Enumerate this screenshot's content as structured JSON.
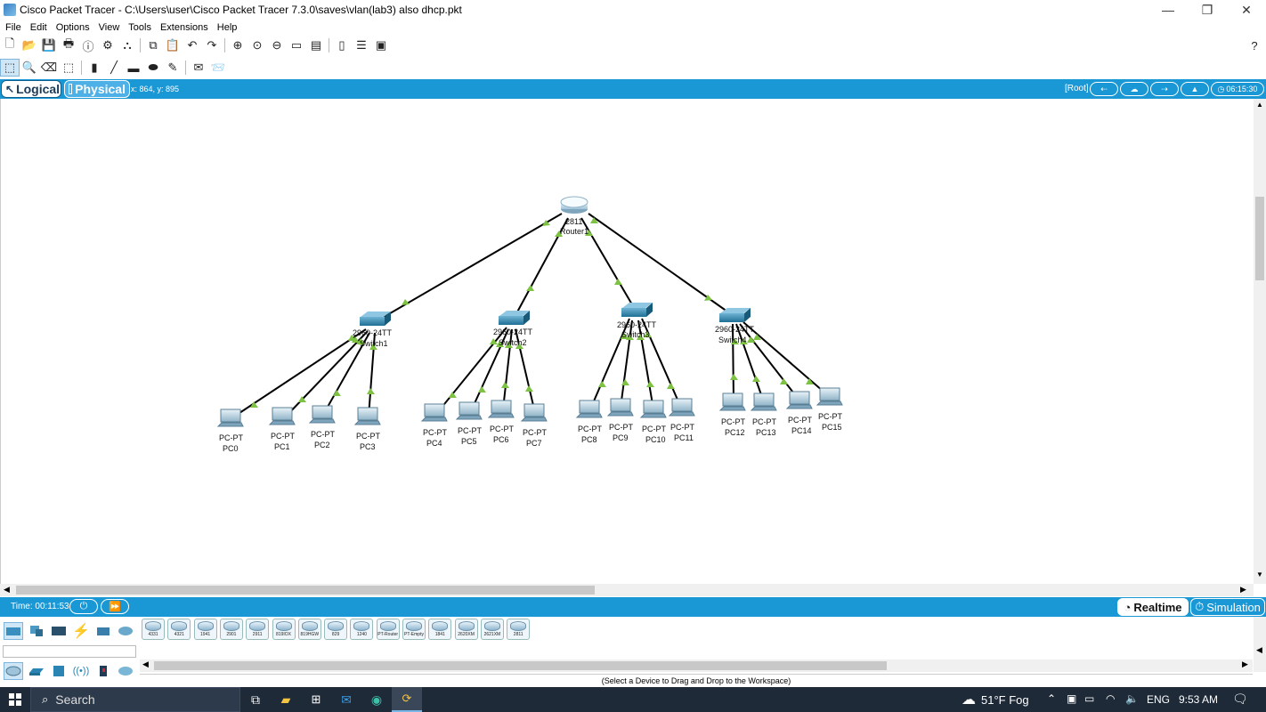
{
  "window": {
    "title": "Cisco Packet Tracer - C:\\Users\\user\\Cisco Packet Tracer 7.3.0\\saves\\vlan(lab3) also dhcp.pkt",
    "minimize": "—",
    "maximize": "❐",
    "close": "✕"
  },
  "menu": [
    "File",
    "Edit",
    "Options",
    "View",
    "Tools",
    "Extensions",
    "Help"
  ],
  "toolbar": {
    "help": "?"
  },
  "workspace_bar": {
    "logical_label": "Logical",
    "physical_label": "Physical",
    "coords": "x: 864, y: 895",
    "root_label": "[Root]",
    "clock": "06:15:30"
  },
  "topology": {
    "router": {
      "model": "2811",
      "name": "Router1"
    },
    "switches": [
      {
        "model": "2960-24TT",
        "name": "Switch1"
      },
      {
        "model": "2960-24TT",
        "name": "Switch2"
      },
      {
        "model": "2960-24TT",
        "name": "Switch3"
      },
      {
        "model": "2960-24TT",
        "name": "Switch4"
      }
    ],
    "pcs": [
      {
        "model": "PC-PT",
        "name": "PC0"
      },
      {
        "model": "PC-PT",
        "name": "PC1"
      },
      {
        "model": "PC-PT",
        "name": "PC2"
      },
      {
        "model": "PC-PT",
        "name": "PC3"
      },
      {
        "model": "PC-PT",
        "name": "PC4"
      },
      {
        "model": "PC-PT",
        "name": "PC5"
      },
      {
        "model": "PC-PT",
        "name": "PC6"
      },
      {
        "model": "PC-PT",
        "name": "PC7"
      },
      {
        "model": "PC-PT",
        "name": "PC8"
      },
      {
        "model": "PC-PT",
        "name": "PC9"
      },
      {
        "model": "PC-PT",
        "name": "PC10"
      },
      {
        "model": "PC-PT",
        "name": "PC11"
      },
      {
        "model": "PC-PT",
        "name": "PC12"
      },
      {
        "model": "PC-PT",
        "name": "PC13"
      },
      {
        "model": "PC-PT",
        "name": "PC14"
      },
      {
        "model": "PC-PT",
        "name": "PC15"
      }
    ],
    "link_color": "#000000",
    "link_status_color": "#7dc242"
  },
  "status": {
    "time_label": "Time: 00:11:53",
    "realtime_label": "Realtime",
    "simulation_label": "Simulation"
  },
  "device_panel": {
    "devices": [
      "4331",
      "4321",
      "1941",
      "2901",
      "2911",
      "819IOX",
      "819HGW",
      "829",
      "1240",
      "PT-Router",
      "PT-Empty",
      "1841",
      "2620XM",
      "2621XM",
      "2811"
    ],
    "hint": "(Select a Device to Drag and Drop to the Workspace)"
  },
  "taskbar": {
    "search_label": "Search",
    "weather": "51°F Fog",
    "language": "ENG",
    "time": "9:53 AM"
  },
  "colors": {
    "accent_blue": "#1a97d5",
    "taskbar": "#1f2a38"
  }
}
